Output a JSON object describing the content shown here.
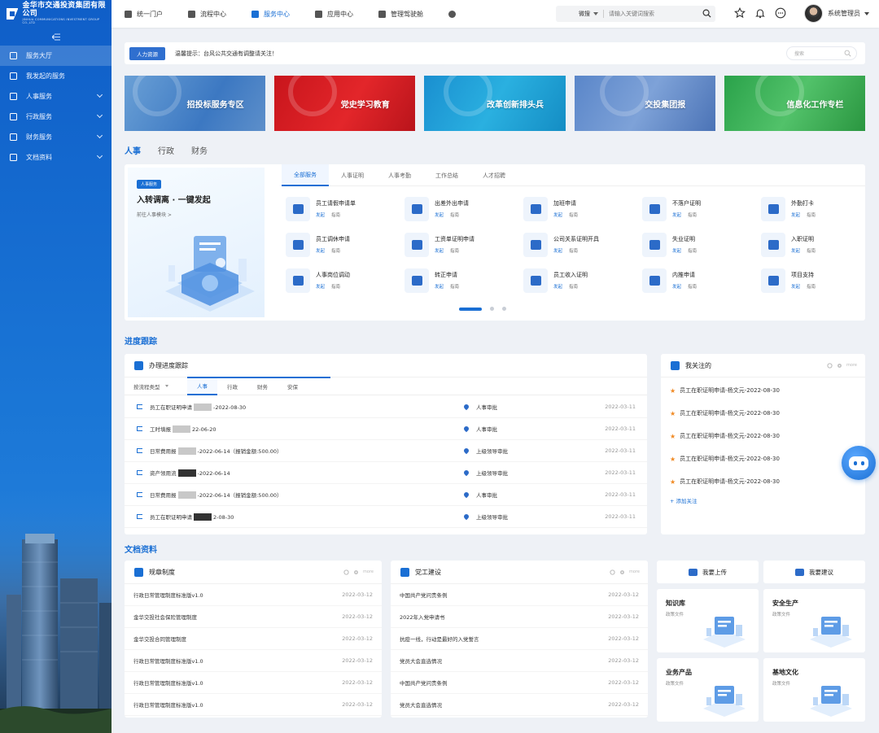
{
  "brand": {
    "name": "金华市交通投资集团有限公司",
    "sub": "JINHUA COMMUNICATIONS INVESTMENT GROUP CO.,LTD"
  },
  "sidebar": {
    "items": [
      {
        "label": "服务大厅",
        "active": true,
        "has_children": false
      },
      {
        "label": "我发起的服务",
        "active": false,
        "has_children": false
      },
      {
        "label": "人事服务",
        "active": false,
        "has_children": true
      },
      {
        "label": "行政服务",
        "active": false,
        "has_children": true
      },
      {
        "label": "财务服务",
        "active": false,
        "has_children": true
      },
      {
        "label": "文档资料",
        "active": false,
        "has_children": true
      }
    ]
  },
  "topnav": {
    "items": [
      {
        "label": "统一门户",
        "icon": "home-icon"
      },
      {
        "label": "流程中心",
        "icon": "flow-icon"
      },
      {
        "label": "服务中心",
        "icon": "book-icon",
        "active": true
      },
      {
        "label": "应用中心",
        "icon": "layers-icon"
      },
      {
        "label": "管理驾驶舱",
        "icon": "clipboard-icon"
      },
      {
        "label": "",
        "icon": "globe-icon"
      }
    ],
    "search_scope": "微搜",
    "search_placeholder": "请输入关键词搜索",
    "user_name": "系统管理员"
  },
  "notice": {
    "tag": "人力资源",
    "message": "温馨提示：台风公共交通有调整请关注！",
    "search_placeholder": "搜索"
  },
  "banners": [
    "招投标服务专区",
    "党史学习教育",
    "改革创新排头兵",
    "交投集团报",
    "信息化工作专栏"
  ],
  "major_tabs": [
    "人事",
    "行政",
    "财务"
  ],
  "hr_promo": {
    "badge": "人事服务",
    "title": "入转调离 · 一键发起",
    "link": "前往人事模块 >"
  },
  "hr_tabs": [
    "全部服务",
    "人事证明",
    "人事考勤",
    "工作总结",
    "人才招聘"
  ],
  "services": {
    "action_start": "发起",
    "action_guide": "指南",
    "items": [
      "员工请假申请单",
      "出差外出申请",
      "加班申请",
      "不落户证明",
      "外勤打卡",
      "员工调休申请",
      "工资单证明申请",
      "公司关系证明开具",
      "失业证明",
      "入职证明",
      "人事岗位调动",
      "转正申请",
      "员工收入证明",
      "内推申请",
      "项目支持"
    ]
  },
  "progress": {
    "section_title": "进度跟踪",
    "panel_title": "办理进度跟踪",
    "filter_label": "按流程类型",
    "tabs": [
      "人事",
      "行政",
      "财务",
      "安保"
    ],
    "rows": [
      {
        "a": "员工在职证明申请",
        "b": "‑2022‑08‑30",
        "status": "人事审批",
        "date": "2022‑03‑11"
      },
      {
        "a": "工时填报",
        "b": "22‑06‑20",
        "status": "人事审批",
        "date": "2022‑03‑11"
      },
      {
        "a": "日常费用报",
        "b": "‑2022‑06‑14（报销金额:500.00）",
        "status": "上级领导审批",
        "date": "2022‑03‑11"
      },
      {
        "a": "资产领用流",
        "b": "‑2022‑06‑14",
        "status": "上级领导审批",
        "date": "2022‑03‑11"
      },
      {
        "a": "日常费用报",
        "b": "‑2022‑06‑14（报销金额:500.00）",
        "status": "人事审批",
        "date": "2022‑03‑11"
      },
      {
        "a": "员工在职证明申请",
        "b": "2‑08‑30",
        "status": "上级领导审批",
        "date": "2022‑03‑11"
      }
    ]
  },
  "follow": {
    "title": "我关注的",
    "more": "more",
    "items": [
      "员工在职证明申请‑杨文元‑2022‑08‑30",
      "员工在职证明申请‑杨文元‑2022‑08‑30",
      "员工在职证明申请‑杨文元‑2022‑08‑30",
      "员工在职证明申请‑杨文元‑2022‑08‑30",
      "员工在职证明申请‑杨文元‑2022‑08‑30"
    ],
    "add": "+ 添加关注"
  },
  "docs": {
    "section_title": "文档资料",
    "rules": {
      "title": "规章制度",
      "more": "more",
      "rows": [
        {
          "name": "行政日常管理制度标准版v1.0",
          "date": "2022‑03‑12"
        },
        {
          "name": "金华交投社会保险管理制度",
          "date": "2022‑03‑12"
        },
        {
          "name": "金华交投合同管理制度",
          "date": "2022‑03‑12"
        },
        {
          "name": "行政日常管理制度标准版v1.0",
          "date": "2022‑03‑12"
        },
        {
          "name": "行政日常管理制度标准版v1.0",
          "date": "2022‑03‑12"
        },
        {
          "name": "行政日常管理制度标准版v1.0",
          "date": "2022‑03‑12"
        }
      ]
    },
    "party": {
      "title": "党工建设",
      "more": "more",
      "rows": [
        {
          "name": "中国共产党问责条例",
          "date": "2022‑03‑12"
        },
        {
          "name": "2022年入党申请书",
          "date": "2022‑03‑12"
        },
        {
          "name": "抗疫一线，行动是最好的入党誓言",
          "date": "2022‑03‑12"
        },
        {
          "name": "党员大会直选情况",
          "date": "2022‑03‑12"
        },
        {
          "name": "中国共产党问责条例",
          "date": "2022‑03‑12"
        },
        {
          "name": "党员大会直选情况",
          "date": "2022‑03‑12"
        }
      ]
    },
    "quick": {
      "upload": "我要上传",
      "suggest": "我要建议"
    },
    "cards": [
      {
        "title": "知识库",
        "sub": "政策文件"
      },
      {
        "title": "安全生产",
        "sub": "政策文件"
      },
      {
        "title": "业务产品",
        "sub": "政策文件"
      },
      {
        "title": "基地文化",
        "sub": "政策文件"
      }
    ]
  },
  "colors": {
    "primary": "#1a6fd4",
    "sidebar": "#1468cf",
    "star": "#f08a24"
  }
}
